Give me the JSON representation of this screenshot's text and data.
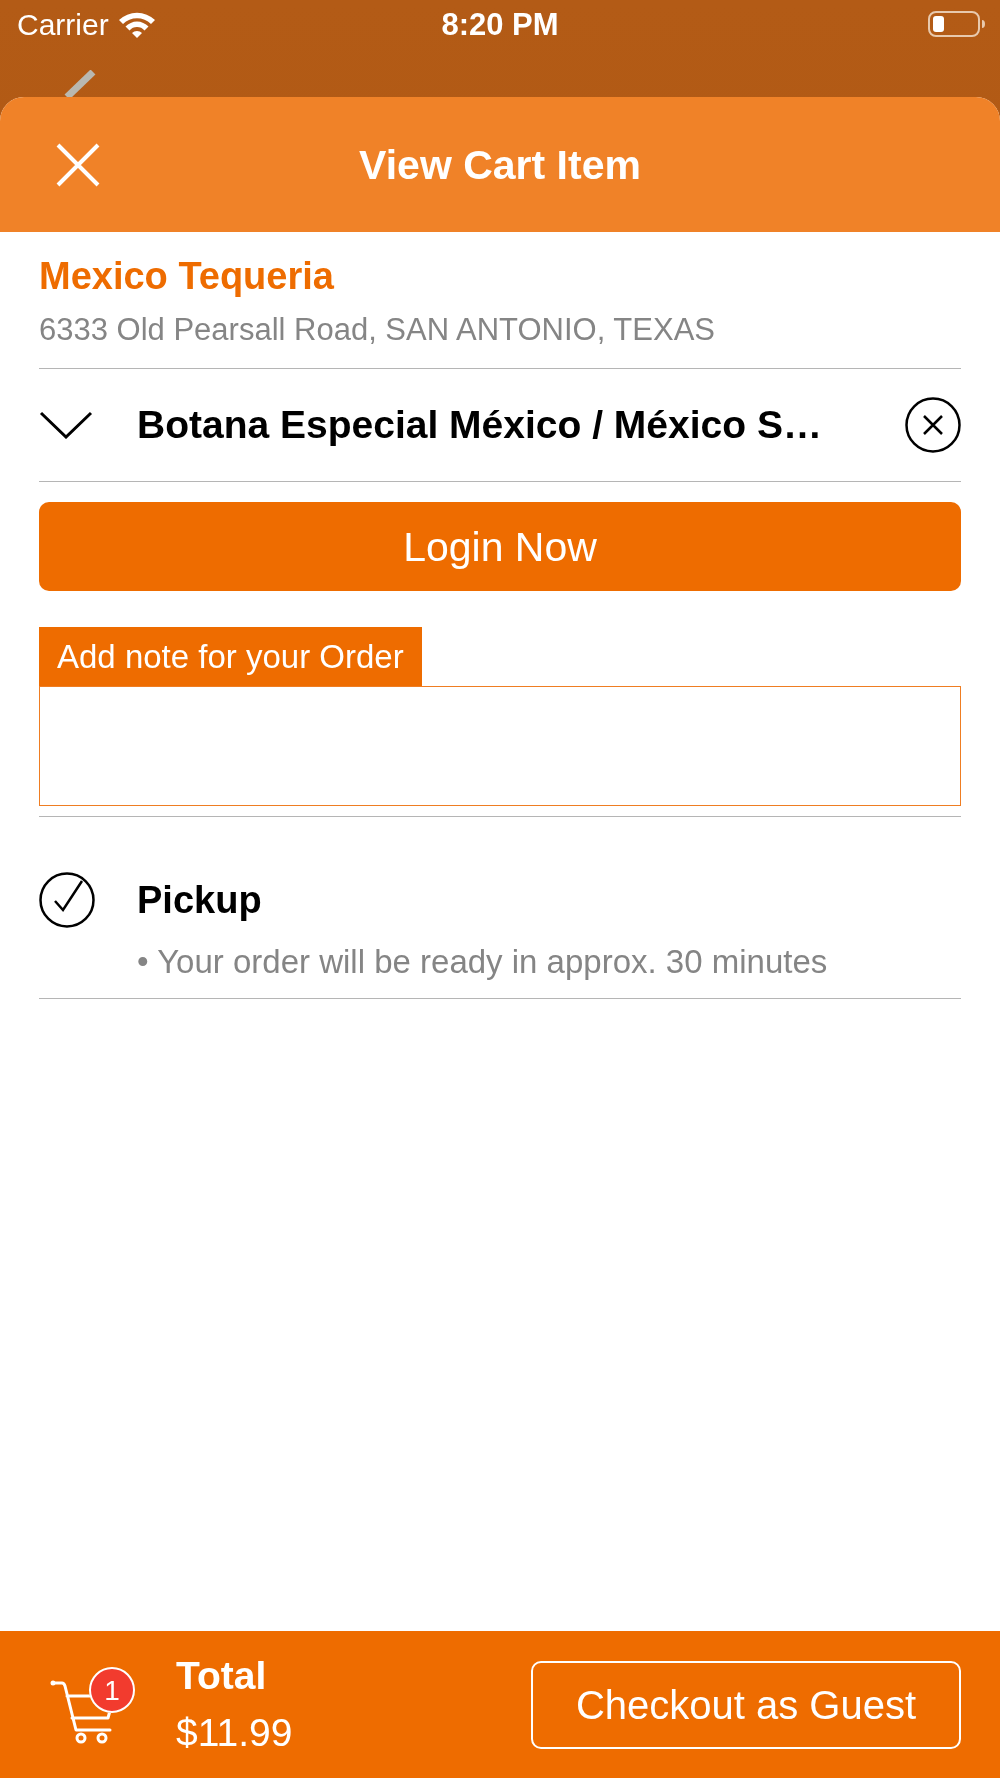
{
  "status_bar": {
    "carrier": "Carrier",
    "time": "8:20 PM"
  },
  "sheet": {
    "title": "View Cart Item"
  },
  "restaurant": {
    "name": "Mexico Tequeria",
    "address": "6333 Old Pearsall Road, SAN ANTONIO, TEXAS"
  },
  "cart_items": [
    {
      "name": "Botana Especial México / México S…",
      "expanded": false
    }
  ],
  "login_button": "Login Now",
  "note": {
    "label": "Add note for your Order"
  },
  "order_options": [
    {
      "label": "Pickup",
      "detail": "• Your order will be ready in approx. 30 minutes",
      "selected": true
    }
  ],
  "footer": {
    "badge": "1",
    "total_label": "Total",
    "total": "$11.99",
    "checkout_button": "Checkout as Guest"
  }
}
